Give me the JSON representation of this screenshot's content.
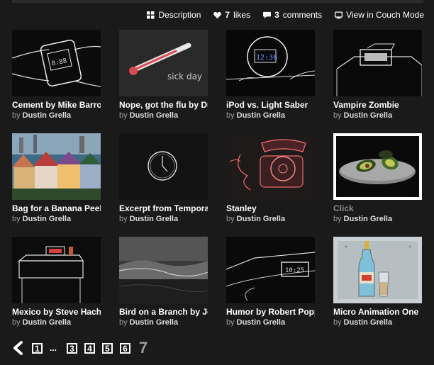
{
  "actions": {
    "description_label": "Description",
    "likes_count": "7",
    "likes_label": "likes",
    "comments_count": "3",
    "comments_label": "comments",
    "couch_label": "View in Couch Mode"
  },
  "videos": [
    {
      "title": "Cement by Mike Barro",
      "by": "by",
      "author": "Dustin Grella"
    },
    {
      "title": "Nope, got the flu by Du",
      "by": "by",
      "author": "Dustin Grella",
      "thumb_text": "sick day"
    },
    {
      "title": "iPod vs. Light Saber",
      "by": "by",
      "author": "Dustin Grella",
      "thumb_text": "12:36"
    },
    {
      "title": "Vampire Zombie",
      "by": "by",
      "author": "Dustin Grella"
    },
    {
      "title": "Bag for a Banana Peel",
      "by": "by",
      "author": "Dustin Grella"
    },
    {
      "title": "Excerpt from Tempora",
      "by": "by",
      "author": "Dustin Grella"
    },
    {
      "title": "Stanley",
      "by": "by",
      "author": "Dustin Grella"
    },
    {
      "title": "Click",
      "by": "by",
      "author": "Dustin Grella"
    },
    {
      "title": "Mexico by Steve Hach",
      "by": "by",
      "author": "Dustin Grella"
    },
    {
      "title": "Bird on a Branch by Jo",
      "by": "by",
      "author": "Dustin Grella"
    },
    {
      "title": "Humor by Robert Popp",
      "by": "by",
      "author": "Dustin Grella",
      "thumb_text": "10:25"
    },
    {
      "title": "Micro Animation One",
      "by": "by",
      "author": "Dustin Grella"
    }
  ],
  "pagination": {
    "pages": [
      "1",
      "3",
      "4",
      "5",
      "6"
    ],
    "ellipsis": "...",
    "current": "7"
  },
  "colors": {
    "background": "#1a1a1a",
    "text": "#ffffff",
    "muted": "#9a9a9a"
  }
}
